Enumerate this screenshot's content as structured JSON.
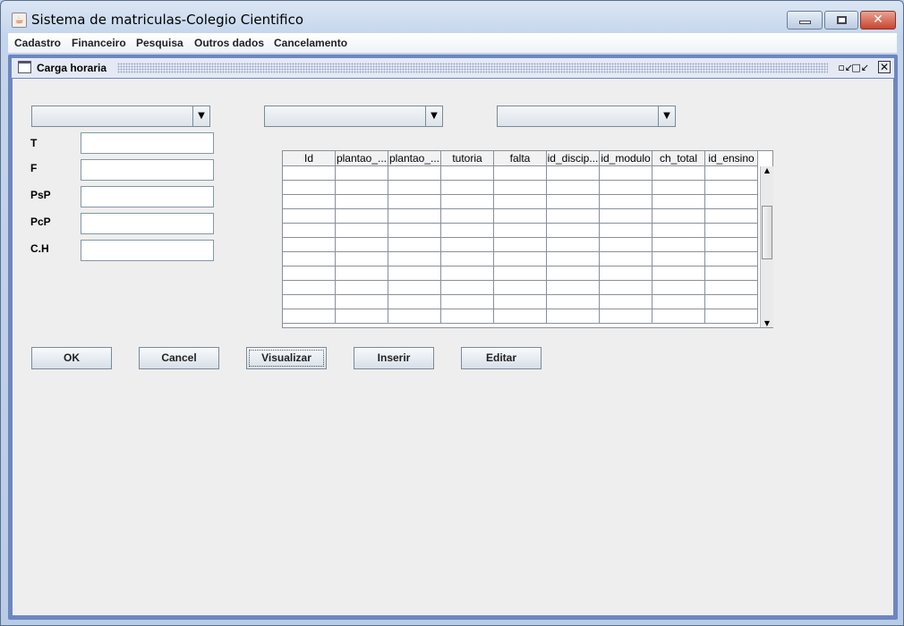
{
  "window": {
    "title": "Sistema de matriculas-Colegio Cientifico",
    "minimize": "—",
    "close": "✕"
  },
  "menu": [
    "Cadastro",
    "Financeiro",
    "Pesquisa",
    "Outros dados",
    "Cancelamento"
  ],
  "internal_frame": {
    "title": "Carga horaria"
  },
  "combos": [
    "",
    "",
    ""
  ],
  "fields": [
    {
      "label": "T",
      "value": ""
    },
    {
      "label": "F",
      "value": ""
    },
    {
      "label": "PsP",
      "value": ""
    },
    {
      "label": "PcP",
      "value": ""
    },
    {
      "label": "C.H",
      "value": ""
    }
  ],
  "table": {
    "columns": [
      "Id",
      "plantao_...",
      "plantao_...",
      "tutoria",
      "falta",
      "id_discip...",
      "id_modulo",
      "ch_total",
      "id_ensino"
    ],
    "rows": 11
  },
  "buttons": [
    "OK",
    "Cancel",
    "Visualizar",
    "Inserir",
    "Editar"
  ]
}
